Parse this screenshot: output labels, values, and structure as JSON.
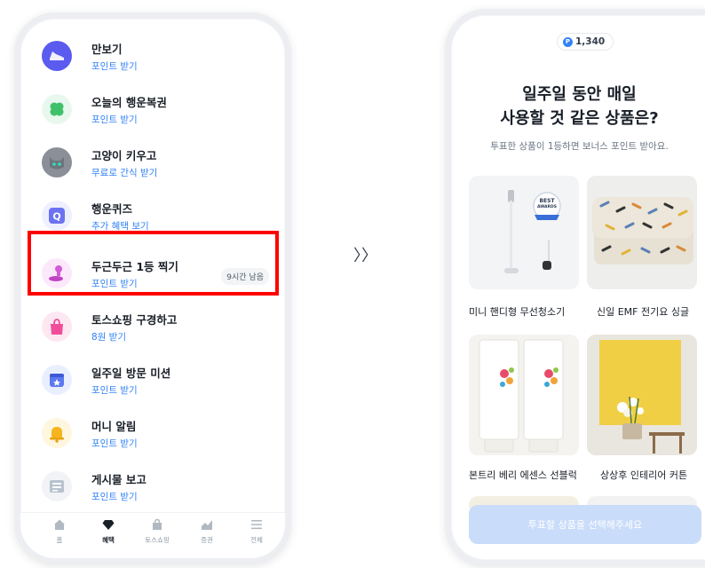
{
  "left_list": {
    "items": [
      {
        "title": "만보기",
        "subtitle": "포인트 받기",
        "icon": "sneaker-icon",
        "color": "#5b5bf0"
      },
      {
        "title": "오늘의 행운복권",
        "subtitle": "포인트 받기",
        "icon": "clover-icon",
        "color": "#3ec16a"
      },
      {
        "title": "고양이 키우고",
        "subtitle": "무료로 간식 받기",
        "icon": "cat-icon",
        "color": "#8a8f98"
      },
      {
        "title": "행운퀴즈",
        "subtitle": "추가 혜택 보기",
        "icon": "quiz-icon",
        "color": "#6b73f2"
      },
      {
        "title": "두근두근 1등 찍기",
        "subtitle": "포인트 받기",
        "icon": "stamp-icon",
        "color": "#d45bd6",
        "badge": "9시간 남음"
      },
      {
        "title": "토스쇼핑 구경하고",
        "subtitle": "8원 받기",
        "icon": "shopping-bag-icon",
        "color": "#f04e9b"
      },
      {
        "title": "일주일 방문 미션",
        "subtitle": "포인트 받기",
        "icon": "calendar-icon",
        "color": "#5a78f0"
      },
      {
        "title": "머니 알림",
        "subtitle": "포인트 받기",
        "icon": "bell-icon",
        "color": "#f6b51e"
      },
      {
        "title": "게시물 보고",
        "subtitle": "포인트 받기",
        "icon": "news-icon",
        "color": "#b8c2cf"
      }
    ]
  },
  "tabbar": {
    "tabs": [
      {
        "label": "홈",
        "icon": "home-icon"
      },
      {
        "label": "혜택",
        "icon": "diamond-icon"
      },
      {
        "label": "토스쇼핑",
        "icon": "bag-icon"
      },
      {
        "label": "증권",
        "icon": "chart-icon"
      },
      {
        "label": "전체",
        "icon": "menu-icon"
      }
    ]
  },
  "arrow": "〉〉",
  "right": {
    "points": "1,340",
    "coin_glyph": "P",
    "title_line1": "일주일 동안 매일",
    "title_line2": "사용할 것 같은 상품은?",
    "subtitle": "투표한 상품이 1등하면 보너스 포인트 받아요.",
    "products": [
      {
        "name": "미니 핸디형 무선청소기",
        "badge_top": "BEST",
        "badge_bottom": "AWARDS"
      },
      {
        "name": "신일 EMF 전기요 싱글"
      },
      {
        "name": "본트리 베리 에센스 선블럭"
      },
      {
        "name": "상상후 인테리어 커튼"
      }
    ],
    "cta": "투표할 상품을 선택해주세요"
  }
}
